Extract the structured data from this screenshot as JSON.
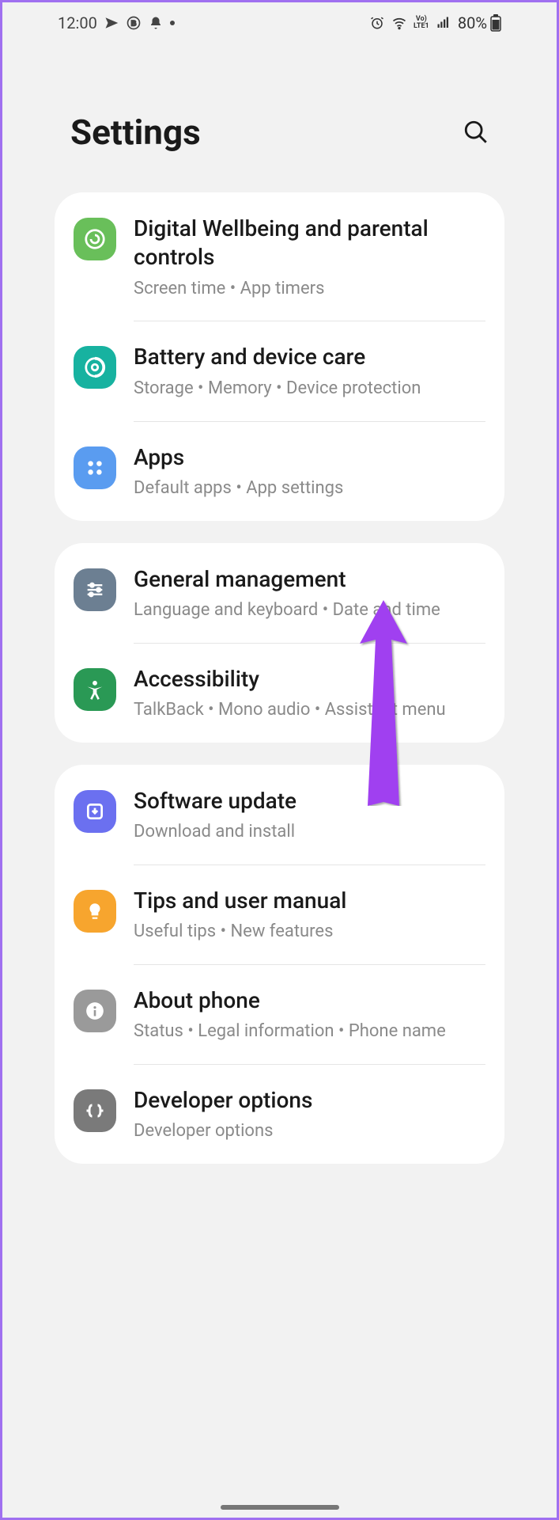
{
  "status": {
    "time": "12:00",
    "battery_pct": "80%"
  },
  "header": {
    "title": "Settings"
  },
  "groups": [
    {
      "items": [
        {
          "title": "Digital Wellbeing and parental controls",
          "sub": "Screen time  •  App timers"
        },
        {
          "title": "Battery and device care",
          "sub": "Storage  •  Memory  •  Device protection"
        },
        {
          "title": "Apps",
          "sub": "Default apps  •  App settings"
        }
      ]
    },
    {
      "items": [
        {
          "title": "General management",
          "sub": "Language and keyboard  •  Date and time"
        },
        {
          "title": "Accessibility",
          "sub": "TalkBack  •  Mono audio  •  Assistant menu"
        }
      ]
    },
    {
      "items": [
        {
          "title": "Software update",
          "sub": "Download and install"
        },
        {
          "title": "Tips and user manual",
          "sub": "Useful tips  •  New features"
        },
        {
          "title": "About phone",
          "sub": "Status  •  Legal information  •  Phone name"
        },
        {
          "title": "Developer options",
          "sub": "Developer options"
        }
      ]
    }
  ]
}
